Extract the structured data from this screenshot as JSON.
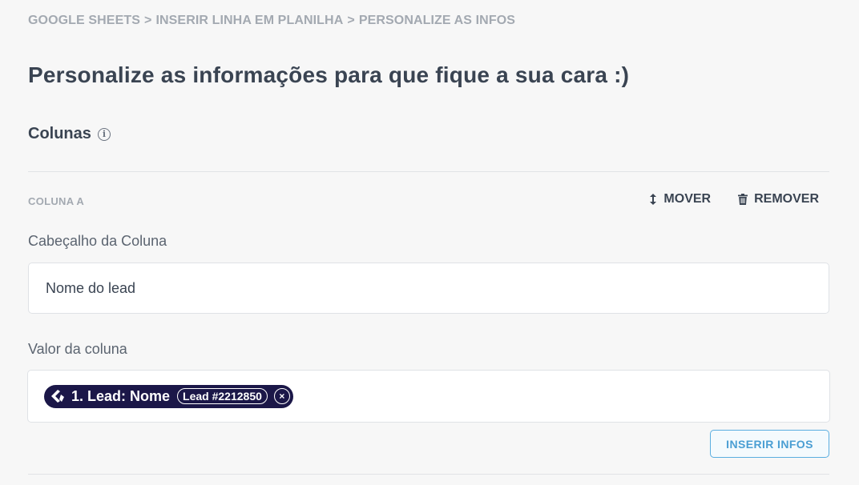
{
  "breadcrumb": {
    "items": [
      "GOOGLE SHEETS",
      "INSERIR LINHA EM PLANILHA",
      "PERSONALIZE AS INFOS"
    ],
    "separator": ">"
  },
  "page_title": "Personalize as informações para que fique a sua cara :)",
  "section": {
    "title": "Colunas",
    "info_glyph": "i"
  },
  "column": {
    "label": "COLUNA A",
    "move_label": "MOVER",
    "remove_label": "REMOVER",
    "header_field_label": "Cabeçalho da Coluna",
    "header_value": "Nome do lead",
    "value_field_label": "Valor da coluna",
    "tag": {
      "text": "1. Lead: Nome",
      "id": "Lead #2212850",
      "close_glyph": "×"
    },
    "insert_button": "INSERIR INFOS"
  },
  "colors": {
    "background": "#f7f7f7",
    "text": "#3a4452",
    "muted": "#a3a9b1",
    "tag_bg": "#1b1748",
    "accent": "#4a9ed3"
  },
  "icons": {
    "move": "arrow-up-down-icon",
    "remove": "trash-icon",
    "info": "info-icon",
    "tag_logo": "app-logo-icon",
    "close": "close-icon"
  }
}
